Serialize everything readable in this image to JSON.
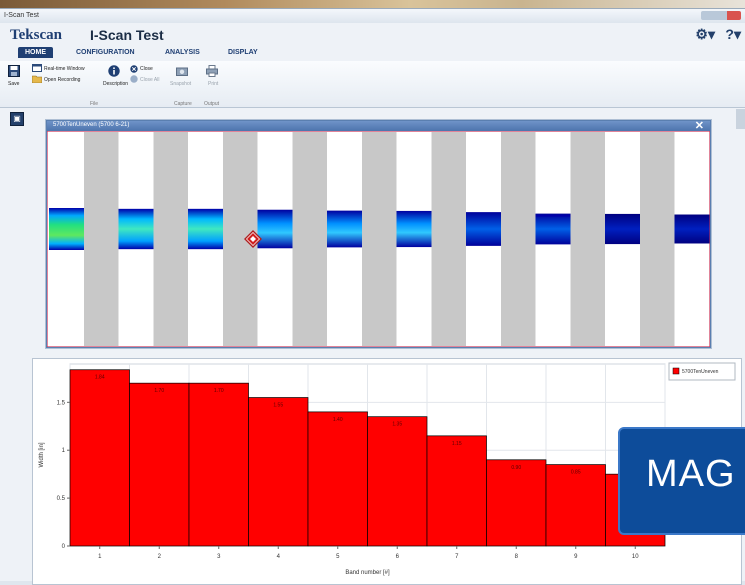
{
  "window": {
    "title": "I-Scan Test"
  },
  "brand": {
    "name": "Tekscan",
    "app_title": "I-Scan Test"
  },
  "tabs": [
    {
      "label": "HOME",
      "active": true
    },
    {
      "label": "CONFIGURATION",
      "active": false
    },
    {
      "label": "ANALYSIS",
      "active": false
    },
    {
      "label": "DISPLAY",
      "active": false
    }
  ],
  "ribbon": {
    "save": "Save",
    "realtime": "Real-time Window",
    "open_recording": "Open Recording",
    "description": "Description",
    "close": "Close",
    "close_all": "Close All",
    "snapshot": "Snapshot",
    "print": "Print",
    "group_file": "File",
    "group_capture": "Capture",
    "group_output": "Output"
  },
  "icons": {
    "gear": "gear-icon",
    "help": "help-icon",
    "save": "floppy-icon",
    "realtime": "window-icon",
    "open": "folder-icon",
    "info": "info-icon",
    "close": "close-icon",
    "snapshot": "camera-icon",
    "print": "printer-icon",
    "panel": "panel-toggle-icon"
  },
  "colors": {
    "accent": "#1f3f73",
    "bar": "#ff0000",
    "sensor_border": "#cc3355"
  },
  "sensor_window": {
    "title": "5700TenUneven (5700 6-21)",
    "close": "✕",
    "columns": 10
  },
  "chart_data": {
    "type": "bar",
    "categories": [
      "1",
      "2",
      "3",
      "4",
      "5",
      "6",
      "7",
      "8",
      "9",
      "10"
    ],
    "series": [
      {
        "name": "5700TenUneven",
        "values": [
          1.84,
          1.7,
          1.7,
          1.55,
          1.4,
          1.35,
          1.15,
          0.9,
          0.85,
          0.75
        ]
      }
    ],
    "data_labels": [
      "1.84",
      "1.70",
      "1.70",
      "1.55",
      "1.40",
      "1.35",
      "1.15",
      "0.90",
      "0.85",
      ""
    ],
    "xlabel": "Band number [#]",
    "ylabel": "Width [in]",
    "ylim": [
      0,
      1.9
    ],
    "yticks": [
      "0",
      "0.5",
      "1",
      "1.5"
    ],
    "grid": true,
    "legend": "top-right"
  },
  "overlay": {
    "text": "MAG"
  }
}
